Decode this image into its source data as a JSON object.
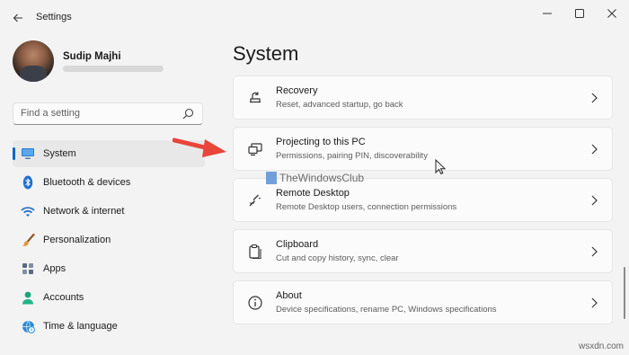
{
  "window": {
    "title": "Settings",
    "controls": {
      "minimize": "─",
      "maximize": "☐",
      "close": "✕"
    }
  },
  "user": {
    "name": "Sudip Majhi"
  },
  "search": {
    "placeholder": "Find a setting"
  },
  "nav": {
    "active_index": 0,
    "accent": "#0067c0",
    "items": [
      {
        "label": "System",
        "icon": "monitor-icon"
      },
      {
        "label": "Bluetooth & devices",
        "icon": "bluetooth-icon"
      },
      {
        "label": "Network & internet",
        "icon": "wifi-icon"
      },
      {
        "label": "Personalization",
        "icon": "brush-icon"
      },
      {
        "label": "Apps",
        "icon": "apps-icon"
      },
      {
        "label": "Accounts",
        "icon": "person-icon"
      },
      {
        "label": "Time & language",
        "icon": "globe-clock-icon"
      }
    ]
  },
  "main": {
    "title": "System",
    "cards": [
      {
        "title": "Recovery",
        "subtitle": "Reset, advanced startup, go back",
        "icon": "recovery-icon"
      },
      {
        "title": "Projecting to this PC",
        "subtitle": "Permissions, pairing PIN, discoverability",
        "icon": "projecting-icon"
      },
      {
        "title": "Remote Desktop",
        "subtitle": "Remote Desktop users, connection permissions",
        "icon": "remote-desktop-icon"
      },
      {
        "title": "Clipboard",
        "subtitle": "Cut and copy history, sync, clear",
        "icon": "clipboard-icon"
      },
      {
        "title": "About",
        "subtitle": "Device specifications, rename PC, Windows specifications",
        "icon": "info-icon"
      }
    ]
  },
  "overlay": {
    "watermark": "TheWindowsClub",
    "corner_mark": "wsxdn.com",
    "arrow_color": "#e8453c"
  }
}
